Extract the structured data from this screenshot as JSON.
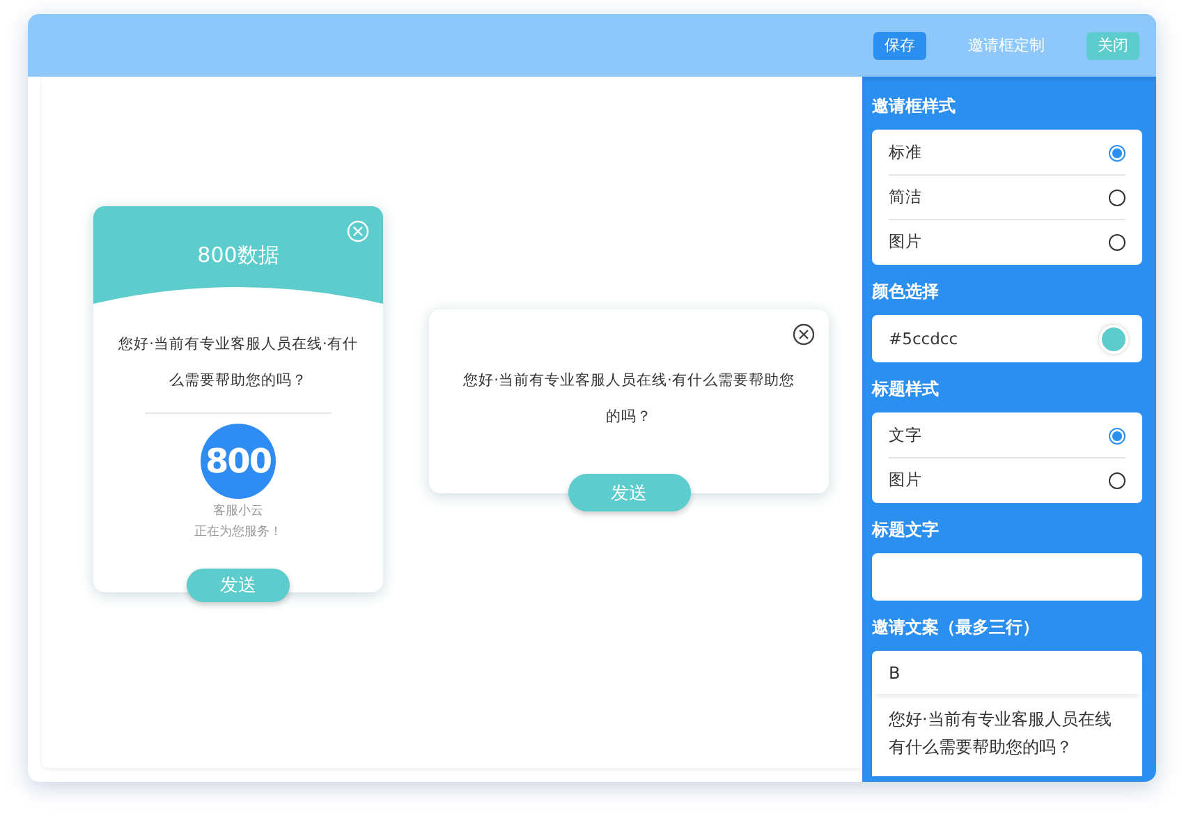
{
  "header": {
    "save": "保存",
    "title": "邀请框定制",
    "close": "关闭"
  },
  "preview_cards": [
    {
      "kind": "standard",
      "title": "800数据",
      "message": "您好·当前有专业客服人员在线·有什么需要帮助您的吗？",
      "logo": "800",
      "agent": "客服小云",
      "status": "正在为您服务！",
      "send": "发送"
    },
    {
      "kind": "simple",
      "message": "您好·当前有专业客服人员在线·有什么需要帮助您的吗？",
      "send": "发送"
    }
  ],
  "sections": [
    {
      "kind": "radio",
      "label": "邀请框样式",
      "options": [
        {
          "label": "标准",
          "selected": true
        },
        {
          "label": "简洁",
          "selected": false
        },
        {
          "label": "图片",
          "selected": false
        }
      ]
    },
    {
      "kind": "color",
      "label": "颜色选择",
      "value": "#5ccdcc"
    },
    {
      "kind": "radio",
      "label": "标题样式",
      "options": [
        {
          "label": "文字",
          "selected": true
        },
        {
          "label": "图片",
          "selected": false
        }
      ]
    },
    {
      "kind": "text",
      "label": "标题文字"
    },
    {
      "kind": "textarea",
      "label": "邀请文案（最多三行）",
      "toolbar": [
        "B"
      ],
      "lines": [
        "您好·当前有专业客服人员在线",
        "有什么需要帮助您的吗？"
      ]
    }
  ]
}
